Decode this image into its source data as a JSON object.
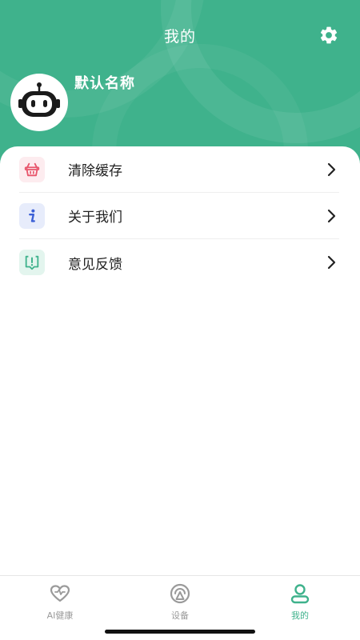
{
  "header": {
    "title": "我的",
    "settings_icon": "gear-icon",
    "background_color": "#3fb28c"
  },
  "profile": {
    "name": "默认名称",
    "avatar_icon": "robot-icon"
  },
  "menu": {
    "items": [
      {
        "label": "清除缓存",
        "icon": "basket-icon",
        "icon_bg": "#fdecef",
        "icon_color": "#e8566c"
      },
      {
        "label": "关于我们",
        "icon": "info-icon",
        "icon_bg": "#e7ecfb",
        "icon_color": "#3b5fd6"
      },
      {
        "label": "意见反馈",
        "icon": "feedback-icon",
        "icon_bg": "#e3f5ee",
        "icon_color": "#3fb28c"
      }
    ]
  },
  "tabbar": {
    "tabs": [
      {
        "label": "AI健康",
        "icon": "heart-icon",
        "active": false
      },
      {
        "label": "设备",
        "icon": "device-icon",
        "active": false
      },
      {
        "label": "我的",
        "icon": "person-icon",
        "active": true
      }
    ],
    "active_color": "#3fb28c",
    "inactive_color": "#9a9a9a"
  }
}
